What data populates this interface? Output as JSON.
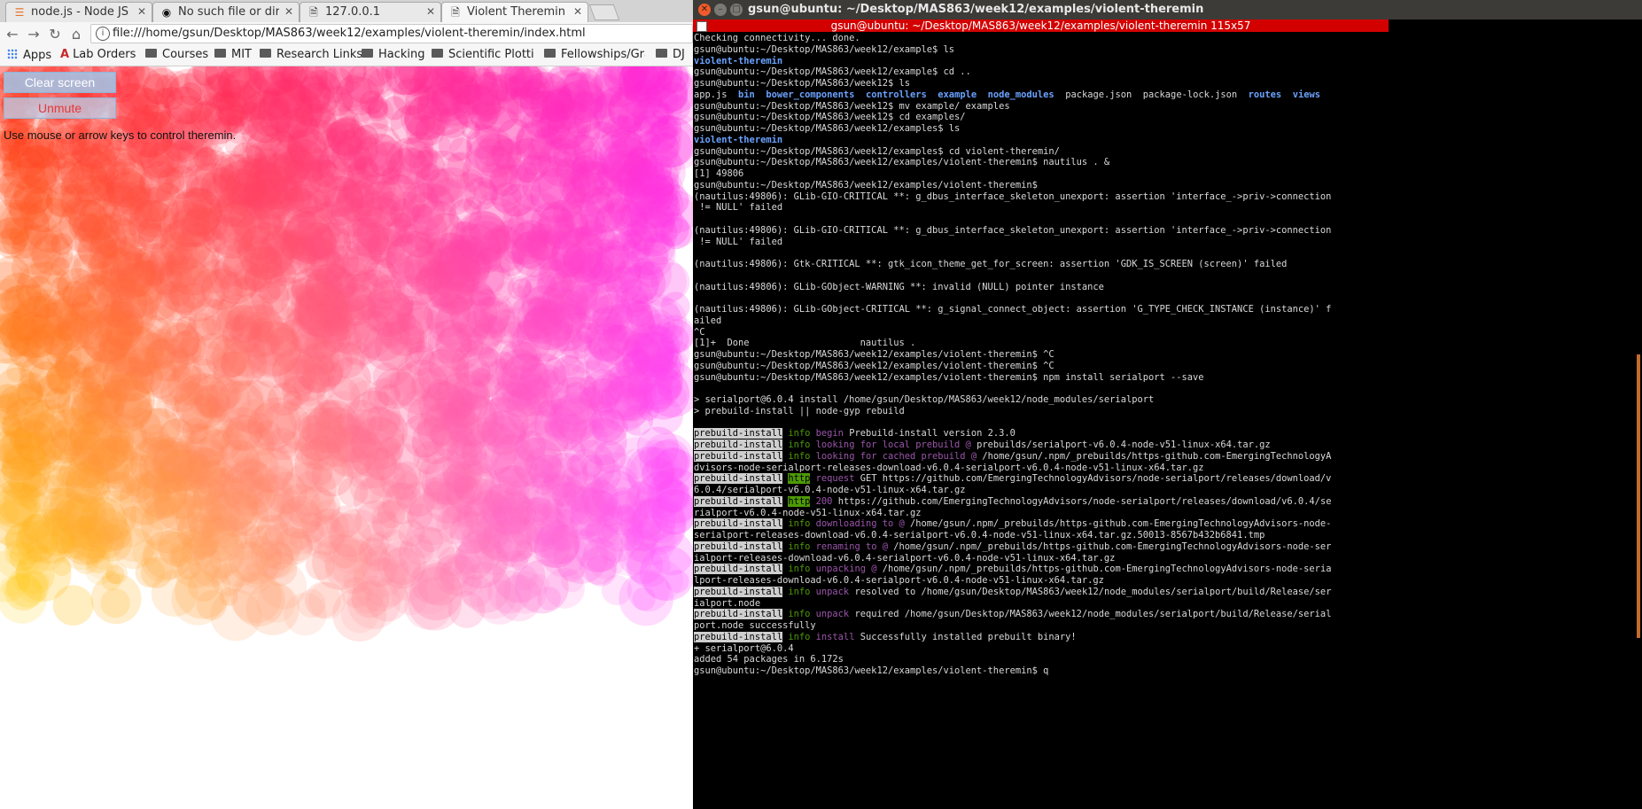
{
  "browser": {
    "tabs": [
      {
        "icon": "nodejs-icon",
        "title": "node.js - Node JS Ex",
        "active": false
      },
      {
        "icon": "github-icon",
        "title": "No such file or direc",
        "active": false
      },
      {
        "icon": "page-icon",
        "title": "127.0.0.1",
        "active": false
      },
      {
        "icon": "page-icon",
        "title": "Violent Theremin",
        "active": true
      }
    ],
    "url": "file:///home/gsun/Desktop/MAS863/week12/examples/violent-theremin/index.html",
    "bookmarks": [
      {
        "type": "apps",
        "label": "Apps"
      },
      {
        "type": "lab",
        "label": "Lab Orders"
      },
      {
        "type": "folder",
        "label": "Courses"
      },
      {
        "type": "folder",
        "label": "MIT"
      },
      {
        "type": "folder",
        "label": "Research Links"
      },
      {
        "type": "folder",
        "label": "Hacking"
      },
      {
        "type": "folder",
        "label": "Scientific Plottin"
      },
      {
        "type": "folder",
        "label": "Fellowships/Gra"
      },
      {
        "type": "folder",
        "label": "DJ"
      }
    ],
    "page": {
      "clear_label": "Clear screen",
      "unmute_label": "Unmute",
      "hint": "Use mouse or arrow keys to control theremin."
    }
  },
  "terminal": {
    "window_title": "gsun@ubuntu: ~/Desktop/MAS863/week12/examples/violent-theremin",
    "tab_title": "gsun@ubuntu: ~/Desktop/MAS863/week12/examples/violent-theremin 115x57",
    "lines": [
      [
        {
          "t": "Checking connectivity... done."
        }
      ],
      [
        {
          "t": "gsun@ubuntu:~/Desktop/MAS863/week12/example$ ls"
        }
      ],
      [
        {
          "t": "violent-theremin",
          "c": "dir"
        }
      ],
      [
        {
          "t": "gsun@ubuntu:~/Desktop/MAS863/week12/example$ cd .."
        }
      ],
      [
        {
          "t": "gsun@ubuntu:~/Desktop/MAS863/week12$ ls"
        }
      ],
      [
        {
          "t": "app.js  "
        },
        {
          "t": "bin",
          "c": "dir"
        },
        {
          "t": "  "
        },
        {
          "t": "bower_components",
          "c": "dir"
        },
        {
          "t": "  "
        },
        {
          "t": "controllers",
          "c": "dir"
        },
        {
          "t": "  "
        },
        {
          "t": "example",
          "c": "dir"
        },
        {
          "t": "  "
        },
        {
          "t": "node_modules",
          "c": "dir"
        },
        {
          "t": "  package.json  package-lock.json  "
        },
        {
          "t": "routes",
          "c": "dir"
        },
        {
          "t": "  "
        },
        {
          "t": "views",
          "c": "dir"
        }
      ],
      [
        {
          "t": "gsun@ubuntu:~/Desktop/MAS863/week12$ mv example/ examples"
        }
      ],
      [
        {
          "t": "gsun@ubuntu:~/Desktop/MAS863/week12$ cd examples/"
        }
      ],
      [
        {
          "t": "gsun@ubuntu:~/Desktop/MAS863/week12/examples$ ls"
        }
      ],
      [
        {
          "t": "violent-theremin",
          "c": "dir"
        }
      ],
      [
        {
          "t": "gsun@ubuntu:~/Desktop/MAS863/week12/examples$ cd violent-theremin/"
        }
      ],
      [
        {
          "t": "gsun@ubuntu:~/Desktop/MAS863/week12/examples/violent-theremin$ nautilus . &"
        }
      ],
      [
        {
          "t": "[1] 49806"
        }
      ],
      [
        {
          "t": "gsun@ubuntu:~/Desktop/MAS863/week12/examples/violent-theremin$"
        }
      ],
      [
        {
          "t": "(nautilus:49806): GLib-GIO-CRITICAL **: g_dbus_interface_skeleton_unexport: assertion 'interface_->priv->connection"
        }
      ],
      [
        {
          "t": " != NULL' failed"
        }
      ],
      [
        {
          "t": ""
        }
      ],
      [
        {
          "t": "(nautilus:49806): GLib-GIO-CRITICAL **: g_dbus_interface_skeleton_unexport: assertion 'interface_->priv->connection"
        }
      ],
      [
        {
          "t": " != NULL' failed"
        }
      ],
      [
        {
          "t": ""
        }
      ],
      [
        {
          "t": "(nautilus:49806): Gtk-CRITICAL **: gtk_icon_theme_get_for_screen: assertion 'GDK_IS_SCREEN (screen)' failed"
        }
      ],
      [
        {
          "t": ""
        }
      ],
      [
        {
          "t": "(nautilus:49806): GLib-GObject-WARNING **: invalid (NULL) pointer instance"
        }
      ],
      [
        {
          "t": ""
        }
      ],
      [
        {
          "t": "(nautilus:49806): GLib-GObject-CRITICAL **: g_signal_connect_object: assertion 'G_TYPE_CHECK_INSTANCE (instance)' f"
        }
      ],
      [
        {
          "t": "ailed"
        }
      ],
      [
        {
          "t": "^C"
        }
      ],
      [
        {
          "t": "[1]+  Done                    nautilus ."
        }
      ],
      [
        {
          "t": "gsun@ubuntu:~/Desktop/MAS863/week12/examples/violent-theremin$ ^C"
        }
      ],
      [
        {
          "t": "gsun@ubuntu:~/Desktop/MAS863/week12/examples/violent-theremin$ ^C"
        }
      ],
      [
        {
          "t": "gsun@ubuntu:~/Desktop/MAS863/week12/examples/violent-theremin$ npm install serialport --save"
        }
      ],
      [
        {
          "t": ""
        }
      ],
      [
        {
          "t": "> serialport@6.0.4 install /home/gsun/Desktop/MAS863/week12/node_modules/serialport"
        }
      ],
      [
        {
          "t": "> prebuild-install || node-gyp rebuild"
        }
      ],
      [
        {
          "t": ""
        }
      ],
      [
        {
          "t": "prebuild-install",
          "c": "pb"
        },
        {
          "t": " "
        },
        {
          "t": "info",
          "c": "info"
        },
        {
          "t": " "
        },
        {
          "t": "begin",
          "c": "log"
        },
        {
          "t": " Prebuild-install version 2.3.0"
        }
      ],
      [
        {
          "t": "prebuild-install",
          "c": "pb"
        },
        {
          "t": " "
        },
        {
          "t": "info",
          "c": "info"
        },
        {
          "t": " "
        },
        {
          "t": "looking for local prebuild @",
          "c": "log"
        },
        {
          "t": " prebuilds/serialport-v6.0.4-node-v51-linux-x64.tar.gz"
        }
      ],
      [
        {
          "t": "prebuild-install",
          "c": "pb"
        },
        {
          "t": " "
        },
        {
          "t": "info",
          "c": "info"
        },
        {
          "t": " "
        },
        {
          "t": "looking for cached prebuild @",
          "c": "log"
        },
        {
          "t": " /home/gsun/.npm/_prebuilds/https-github.com-EmergingTechnologyA"
        }
      ],
      [
        {
          "t": "dvisors-node-serialport-releases-download-v6.0.4-serialport-v6.0.4-node-v51-linux-x64.tar.gz"
        }
      ],
      [
        {
          "t": "prebuild-install",
          "c": "pb"
        },
        {
          "t": " "
        },
        {
          "t": "http",
          "c": "http"
        },
        {
          "t": " "
        },
        {
          "t": "request",
          "c": "log"
        },
        {
          "t": " GET https://github.com/EmergingTechnologyAdvisors/node-serialport/releases/download/v"
        }
      ],
      [
        {
          "t": "6.0.4/serialport-v6.0.4-node-v51-linux-x64.tar.gz"
        }
      ],
      [
        {
          "t": "prebuild-install",
          "c": "pb"
        },
        {
          "t": " "
        },
        {
          "t": "http",
          "c": "http"
        },
        {
          "t": " "
        },
        {
          "t": "200",
          "c": "log"
        },
        {
          "t": " https://github.com/EmergingTechnologyAdvisors/node-serialport/releases/download/v6.0.4/se"
        }
      ],
      [
        {
          "t": "rialport-v6.0.4-node-v51-linux-x64.tar.gz"
        }
      ],
      [
        {
          "t": "prebuild-install",
          "c": "pb"
        },
        {
          "t": " "
        },
        {
          "t": "info",
          "c": "info"
        },
        {
          "t": " "
        },
        {
          "t": "downloading to @",
          "c": "log"
        },
        {
          "t": " /home/gsun/.npm/_prebuilds/https-github.com-EmergingTechnologyAdvisors-node-"
        }
      ],
      [
        {
          "t": "serialport-releases-download-v6.0.4-serialport-v6.0.4-node-v51-linux-x64.tar.gz.50013-8567b432b6841.tmp"
        }
      ],
      [
        {
          "t": "prebuild-install",
          "c": "pb"
        },
        {
          "t": " "
        },
        {
          "t": "info",
          "c": "info"
        },
        {
          "t": " "
        },
        {
          "t": "renaming to @",
          "c": "log"
        },
        {
          "t": " /home/gsun/.npm/_prebuilds/https-github.com-EmergingTechnologyAdvisors-node-ser"
        }
      ],
      [
        {
          "t": "ialport-releases-download-v6.0.4-serialport-v6.0.4-node-v51-linux-x64.tar.gz"
        }
      ],
      [
        {
          "t": "prebuild-install",
          "c": "pb"
        },
        {
          "t": " "
        },
        {
          "t": "info",
          "c": "info"
        },
        {
          "t": " "
        },
        {
          "t": "unpacking @",
          "c": "log"
        },
        {
          "t": " /home/gsun/.npm/_prebuilds/https-github.com-EmergingTechnologyAdvisors-node-seria"
        }
      ],
      [
        {
          "t": "lport-releases-download-v6.0.4-serialport-v6.0.4-node-v51-linux-x64.tar.gz"
        }
      ],
      [
        {
          "t": "prebuild-install",
          "c": "pb"
        },
        {
          "t": " "
        },
        {
          "t": "info",
          "c": "info"
        },
        {
          "t": " "
        },
        {
          "t": "unpack",
          "c": "log"
        },
        {
          "t": " resolved to /home/gsun/Desktop/MAS863/week12/node_modules/serialport/build/Release/ser"
        }
      ],
      [
        {
          "t": "ialport.node"
        }
      ],
      [
        {
          "t": "prebuild-install",
          "c": "pb"
        },
        {
          "t": " "
        },
        {
          "t": "info",
          "c": "info"
        },
        {
          "t": " "
        },
        {
          "t": "unpack",
          "c": "log"
        },
        {
          "t": " required /home/gsun/Desktop/MAS863/week12/node_modules/serialport/build/Release/serial"
        }
      ],
      [
        {
          "t": "port.node successfully"
        }
      ],
      [
        {
          "t": "prebuild-install",
          "c": "pb"
        },
        {
          "t": " "
        },
        {
          "t": "info",
          "c": "info"
        },
        {
          "t": " "
        },
        {
          "t": "install",
          "c": "log"
        },
        {
          "t": " Successfully installed prebuilt binary!"
        }
      ],
      [
        {
          "t": "+ serialport@6.0.4"
        }
      ],
      [
        {
          "t": "added 54 packages in 6.172s"
        }
      ],
      [
        {
          "t": "gsun@ubuntu:~/Desktop/MAS863/week12/examples/violent-theremin$ q"
        }
      ]
    ]
  },
  "colors": {
    "terminal_tab": "#d30000",
    "terminal_bg": "#000000",
    "directory": "#6aa2ff",
    "info_green": "#4e9a06",
    "log_purple": "#9a55aa"
  }
}
